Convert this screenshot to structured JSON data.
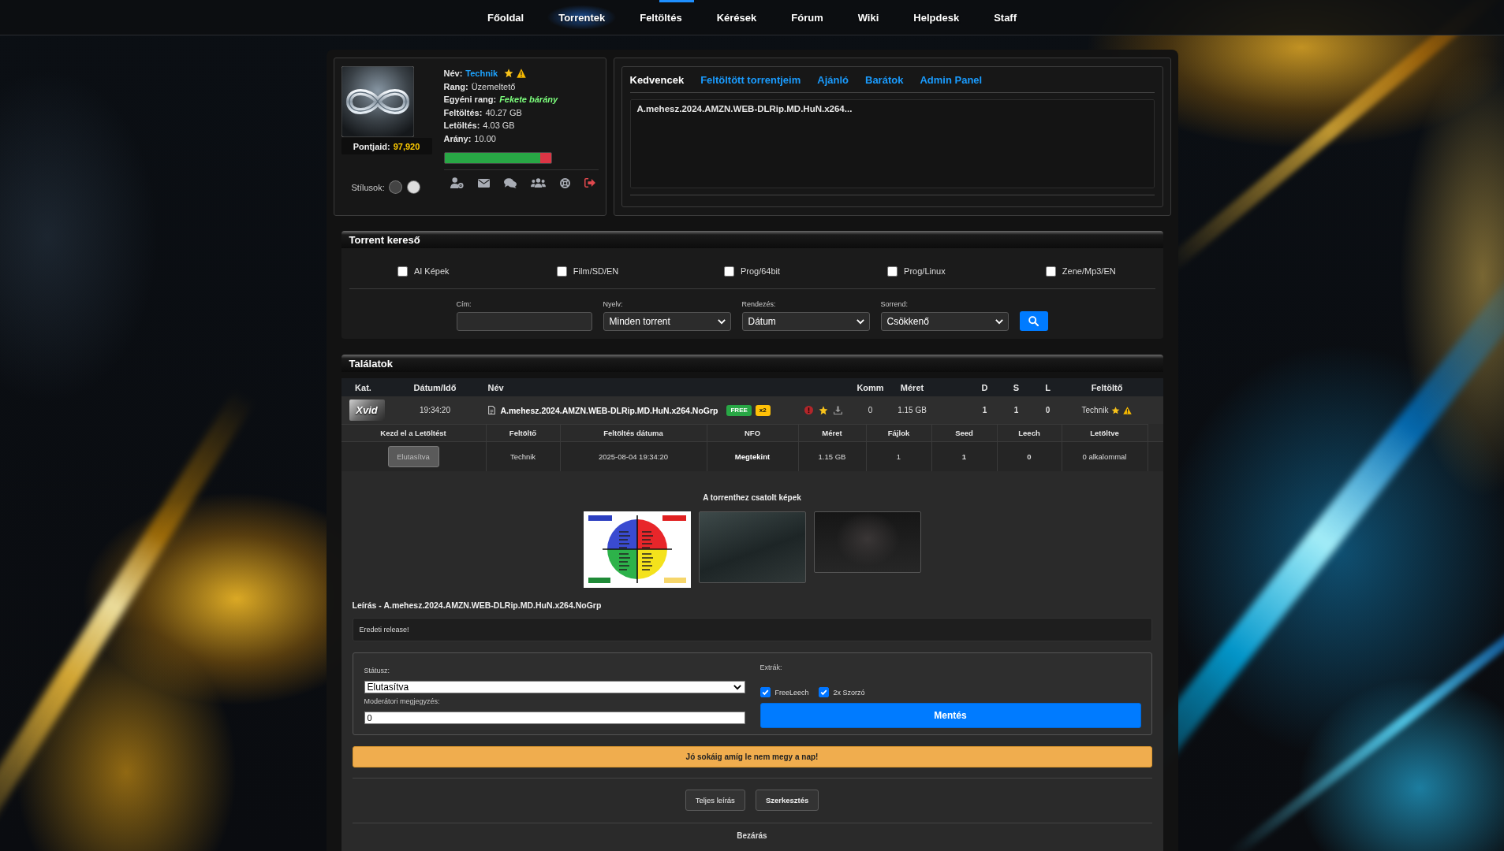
{
  "nav": {
    "items": [
      {
        "label": "Főoldal",
        "selected": false
      },
      {
        "label": "Torrentek",
        "selected": true
      },
      {
        "label": "Feltöltés",
        "selected": false
      },
      {
        "label": "Kérések",
        "selected": false
      },
      {
        "label": "Fórum",
        "selected": false
      },
      {
        "label": "Wiki",
        "selected": false
      },
      {
        "label": "Helpdesk",
        "selected": false
      },
      {
        "label": "Staff",
        "selected": false
      }
    ]
  },
  "profile": {
    "points_label": "Pontjaid:",
    "points": "97,920",
    "styles_label": "Stílusok:",
    "styles": [
      {
        "color": "#444444"
      },
      {
        "color": "#dddddd"
      }
    ],
    "fields": [
      {
        "label": "Név:",
        "value": "Technik",
        "kind": "user"
      },
      {
        "label": "Rang:",
        "value": "Üzemeltető",
        "kind": "plain"
      },
      {
        "label": "Egyéni rang:",
        "value": "Fekete bárány",
        "kind": "title"
      },
      {
        "label": "Feltöltés:",
        "value": "40.27 GB",
        "kind": "plain"
      },
      {
        "label": "Letöltés:",
        "value": "4.03 GB",
        "kind": "plain"
      },
      {
        "label": "Arány:",
        "value": "10.00",
        "kind": "plain"
      }
    ],
    "ratio_bar": {
      "level": 0.9
    }
  },
  "favorites": {
    "tabs": [
      {
        "label": "Kedvencek",
        "selected": true
      },
      {
        "label": "Feltöltött torrentjeim",
        "selected": false
      },
      {
        "label": "Ajánló",
        "selected": false
      },
      {
        "label": "Barátok",
        "selected": false
      },
      {
        "label": "Admin Panel",
        "selected": false
      }
    ],
    "items": [
      "A.mehesz.2024.AMZN.WEB-DLRip.MD.HuN.x264..."
    ]
  },
  "search": {
    "title": "Torrent kereső",
    "categories": [
      {
        "label": "AI Képek",
        "checked": false
      },
      {
        "label": "Film/SD/EN",
        "checked": false
      },
      {
        "label": "Prog/64bit",
        "checked": false
      },
      {
        "label": "Prog/Linux",
        "checked": false
      },
      {
        "label": "Zene/Mp3/EN",
        "checked": false
      }
    ],
    "fields": [
      {
        "label": "Cím:",
        "kind": "text"
      },
      {
        "label": "Nyelv:",
        "kind": "select",
        "value": "Minden torrent"
      },
      {
        "label": "Rendezés:",
        "kind": "select",
        "value": "Dátum"
      },
      {
        "label": "Sorrend:",
        "kind": "select",
        "value": "Csökkenő"
      }
    ]
  },
  "results": {
    "title": "Találatok",
    "columns": [
      "Kat.",
      "Dátum/Idő",
      "Név",
      "Komm",
      "Méret",
      "D",
      "S",
      "L",
      "Feltöltő"
    ],
    "rows": [
      {
        "category": "Xvid",
        "time": "19:34:20",
        "name": "A.mehesz.2024.AMZN.WEB-DLRip.MD.HuN.x264.NoGrp",
        "badges": [
          {
            "label": "FREE",
            "color": "#28a745"
          },
          {
            "label": "x2",
            "color": "#ffc107"
          }
        ],
        "comments": "0",
        "size": "1.15 GB",
        "d": "1",
        "s": "1",
        "l": "0",
        "uploader": "Technik"
      }
    ]
  },
  "details": {
    "columns": [
      "Kezd el a Letöltést",
      "Feltöltő",
      "Feltöltés dátuma",
      "NFO",
      "Méret",
      "Fájlok",
      "Seed",
      "Leech",
      "Letöltve"
    ],
    "cells": [
      {
        "text": "Elutasítva",
        "kind": "button",
        "disabled": true
      },
      {
        "text": "Technik",
        "kind": "plain"
      },
      {
        "text": "2025-08-04 19:34:20",
        "kind": "plain"
      },
      {
        "text": "Megtekint",
        "kind": "link"
      },
      {
        "text": "1.15 GB",
        "kind": "plain"
      },
      {
        "text": "1",
        "kind": "plain"
      },
      {
        "text": "1",
        "kind": "strong"
      },
      {
        "text": "0",
        "kind": "strong"
      },
      {
        "text": "0 alkalommal",
        "kind": "plain"
      }
    ]
  },
  "attachments": {
    "title": "A torrenthez csatolt képek",
    "images": [
      {
        "kind": "chart"
      },
      {
        "kind": "photo"
      },
      {
        "kind": "photo"
      }
    ]
  },
  "description": {
    "title": "Leírás - A.mehesz.2024.AMZN.WEB-DLRip.MD.HuN.x264.NoGrp",
    "text": "Eredeti release!"
  },
  "moderation": {
    "status_label": "Státusz:",
    "status": "Elutasítva",
    "note_label": "Moderátori megjegyzés:",
    "note": "0",
    "extras_label": "Extrák:",
    "extras": [
      {
        "label": "FreeLeech",
        "checked": true
      },
      {
        "label": "2x Szorzó",
        "checked": true
      }
    ],
    "save": "Mentés"
  },
  "banner": "Jó sokáig amíg le nem megy a nap!",
  "actions": [
    {
      "label": "Teljes leírás",
      "kind": "default"
    },
    {
      "label": "Szerkesztés",
      "kind": "strong"
    }
  ],
  "close": "Bezárás"
}
